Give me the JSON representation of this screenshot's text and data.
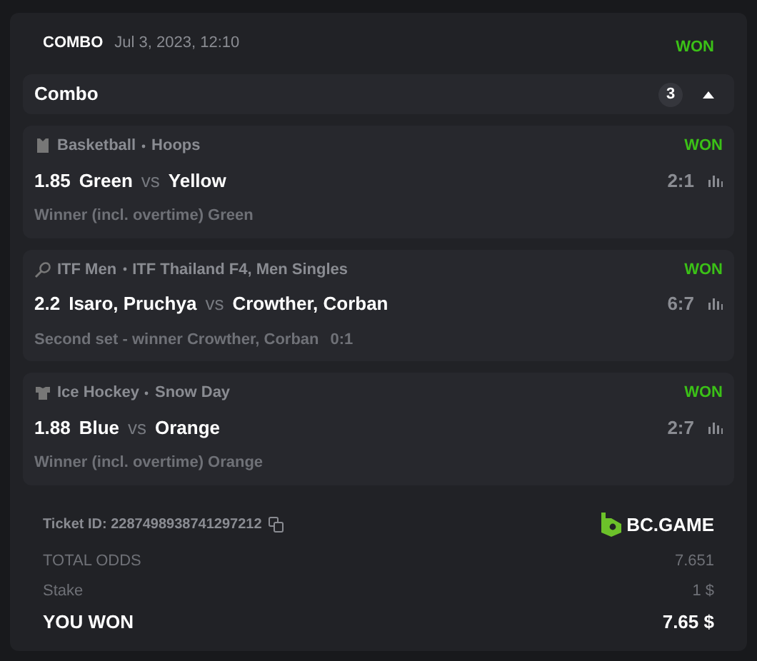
{
  "header": {
    "type": "COMBO",
    "date": "Jul 3, 2023, 12:10",
    "status": "WON"
  },
  "combo": {
    "title": "Combo",
    "count": "3",
    "expanded": true
  },
  "legs": [
    {
      "kind": "basketball",
      "sport": "Basketball",
      "league": "Hoops",
      "status": "WON",
      "odds": "1.85",
      "home": "Green",
      "vs": "vs",
      "away": "Yellow",
      "score": "2:1",
      "market": "Winner (incl. overtime) Green"
    },
    {
      "kind": "tennis",
      "sport": "ITF Men",
      "league": "ITF Thailand F4, Men Singles",
      "status": "WON",
      "odds": "2.2",
      "home": "Isaro, Pruchya",
      "vs": "vs",
      "away": "Crowther, Corban",
      "score": "6:7",
      "market": "Second set - winner Crowther, Corban",
      "market_score": "0:1"
    },
    {
      "kind": "hockey",
      "sport": "Ice Hockey",
      "league": "Snow Day",
      "status": "WON",
      "odds": "1.88",
      "home": "Blue",
      "vs": "vs",
      "away": "Orange",
      "score": "2:7",
      "market": "Winner (incl. overtime) Orange"
    }
  ],
  "ticket": {
    "label": "Ticket ID: 2287498938741297212",
    "brand": "BC.GAME"
  },
  "summary": [
    {
      "kind": "muted",
      "label": "TOTAL ODDS",
      "value": "7.651"
    },
    {
      "kind": "muted",
      "label": "Stake",
      "value": "1 $"
    },
    {
      "kind": "total",
      "label": "YOU WON",
      "value": "7.65 $"
    }
  ]
}
